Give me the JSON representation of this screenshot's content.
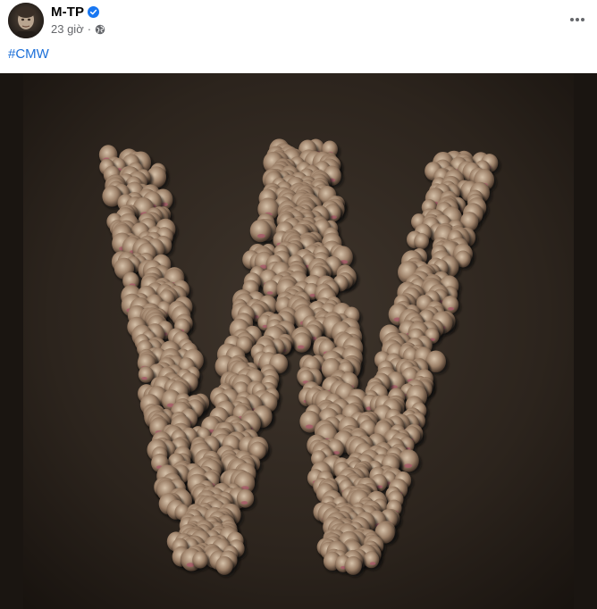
{
  "post": {
    "author": "M-TP",
    "timestamp": "23 giờ",
    "separator": "·",
    "audience_icon": "globe-icon",
    "verified_icon": "verified-badge-icon",
    "more_icon": "more-horizontal-icon",
    "caption_hashtag": "#CMW",
    "photo_content": "letter W formed from small figurine heads on dark textured background"
  },
  "colors": {
    "hashtag": "#1b6fd9",
    "secondary_text": "#65676b",
    "verified": "#1877f2",
    "photo_background": "#2b221b"
  }
}
